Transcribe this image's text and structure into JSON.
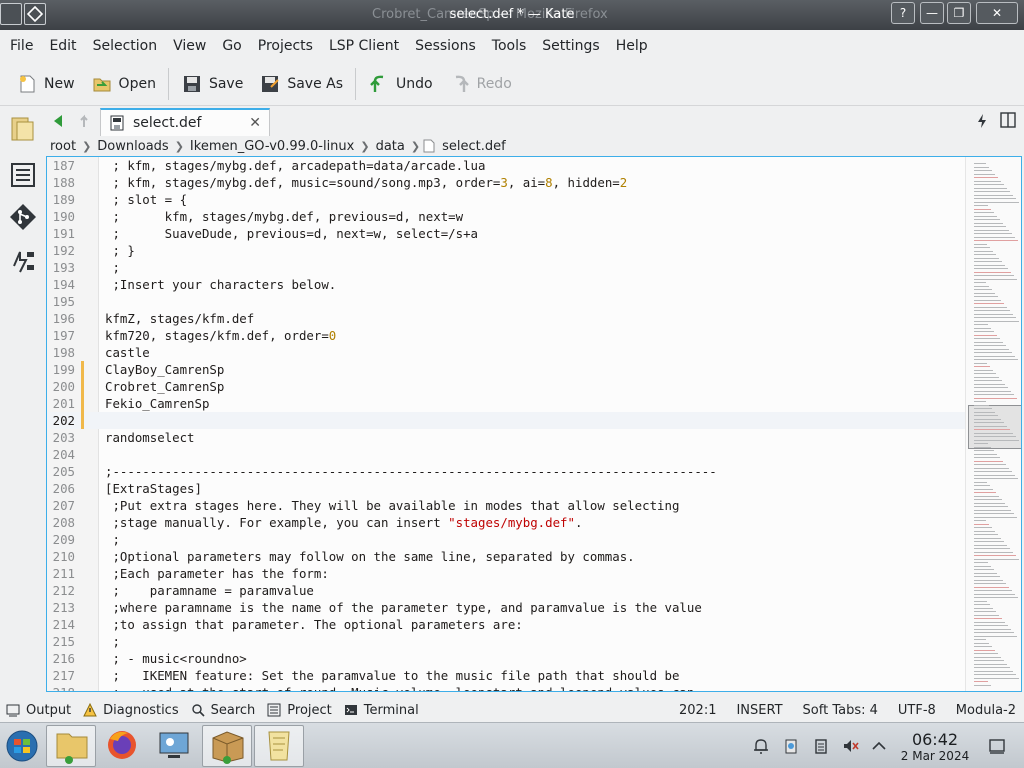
{
  "window": {
    "title": "select.def * — Kate",
    "ghost_title": "Crobret_CamrenSp — Mozilla Firefox",
    "controls": {
      "help": "?",
      "minimize": "—",
      "maximize": "❐",
      "close": "✕"
    }
  },
  "menubar": {
    "items": [
      "File",
      "Edit",
      "Selection",
      "View",
      "Go",
      "Projects",
      "LSP Client",
      "Sessions",
      "Tools",
      "Settings",
      "Help"
    ]
  },
  "toolbar": {
    "new": "New",
    "open": "Open",
    "save": "Save",
    "save_as": "Save As",
    "undo": "Undo",
    "redo": "Redo"
  },
  "tabs": [
    {
      "label": "select.def",
      "close": "✕"
    }
  ],
  "breadcrumb": [
    "root",
    "Downloads",
    "Ikemen_GO-v0.99.0-linux",
    "data",
    "select.def"
  ],
  "editor": {
    "lines": [
      {
        "n": "187",
        "text": " ; kfm, stages/mybg.def, arcadepath=data/arcade.lua"
      },
      {
        "n": "188",
        "text": " ; kfm, stages/mybg.def, music=sound/song.mp3, order=3, ai=8, hidden=2"
      },
      {
        "n": "189",
        "text": " ; slot = {"
      },
      {
        "n": "190",
        "text": " ;      kfm, stages/mybg.def, previous=d, next=w"
      },
      {
        "n": "191",
        "text": " ;      SuaveDude, previous=d, next=w, select=/s+a"
      },
      {
        "n": "192",
        "text": " ; }"
      },
      {
        "n": "193",
        "text": " ;"
      },
      {
        "n": "194",
        "text": " ;Insert your characters below."
      },
      {
        "n": "195",
        "text": ""
      },
      {
        "n": "196",
        "text": "kfmZ, stages/kfm.def"
      },
      {
        "n": "197",
        "text": "kfm720, stages/kfm.def, order=0"
      },
      {
        "n": "198",
        "text": "castle"
      },
      {
        "n": "199",
        "text": "ClayBoy_CamrenSp"
      },
      {
        "n": "200",
        "text": "Crobret_CamrenSp"
      },
      {
        "n": "201",
        "text": "Fekio_CamrenSp"
      },
      {
        "n": "202",
        "text": ""
      },
      {
        "n": "203",
        "text": "randomselect"
      },
      {
        "n": "204",
        "text": ""
      },
      {
        "n": "205",
        "text": ";---------------------------------------------------------------------------------"
      },
      {
        "n": "206",
        "text": "[ExtraStages]"
      },
      {
        "n": "207",
        "text": " ;Put extra stages here. They will be available in modes that allow selecting"
      },
      {
        "n": "208",
        "text": " ;stage manually. For example, you can insert \"stages/mybg.def\"."
      },
      {
        "n": "209",
        "text": " ;"
      },
      {
        "n": "210",
        "text": " ;Optional parameters may follow on the same line, separated by commas."
      },
      {
        "n": "211",
        "text": " ;Each parameter has the form:"
      },
      {
        "n": "212",
        "text": " ;    paramname = paramvalue"
      },
      {
        "n": "213",
        "text": " ;where paramname is the name of the parameter type, and paramvalue is the value"
      },
      {
        "n": "214",
        "text": " ;to assign that parameter. The optional parameters are:"
      },
      {
        "n": "215",
        "text": " ;"
      },
      {
        "n": "216",
        "text": " ; - music<roundno>"
      },
      {
        "n": "217",
        "text": " ;   IKEMEN feature: Set the paramvalue to the music file path that should be"
      },
      {
        "n": "218",
        "text": " ;   used at the start of round. Music volume, loopstart and loopend values can"
      }
    ],
    "current_line": "202",
    "modified_lines": [
      "199",
      "200",
      "201",
      "202"
    ]
  },
  "bottom_panel": {
    "output": "Output",
    "diagnostics": "Diagnostics",
    "search": "Search",
    "project": "Project",
    "terminal": "Terminal"
  },
  "status": {
    "cursor": "202:1",
    "mode": "INSERT",
    "indent": "Soft Tabs: 4",
    "encoding": "UTF-8",
    "syntax": "Modula-2"
  },
  "taskbar": {
    "time": "06:42",
    "date": "2 Mar 2024"
  },
  "colors": {
    "accent": "#3daee9",
    "modified_marker": "#f0b84a",
    "number": "#b08000",
    "string": "#bf0303"
  }
}
